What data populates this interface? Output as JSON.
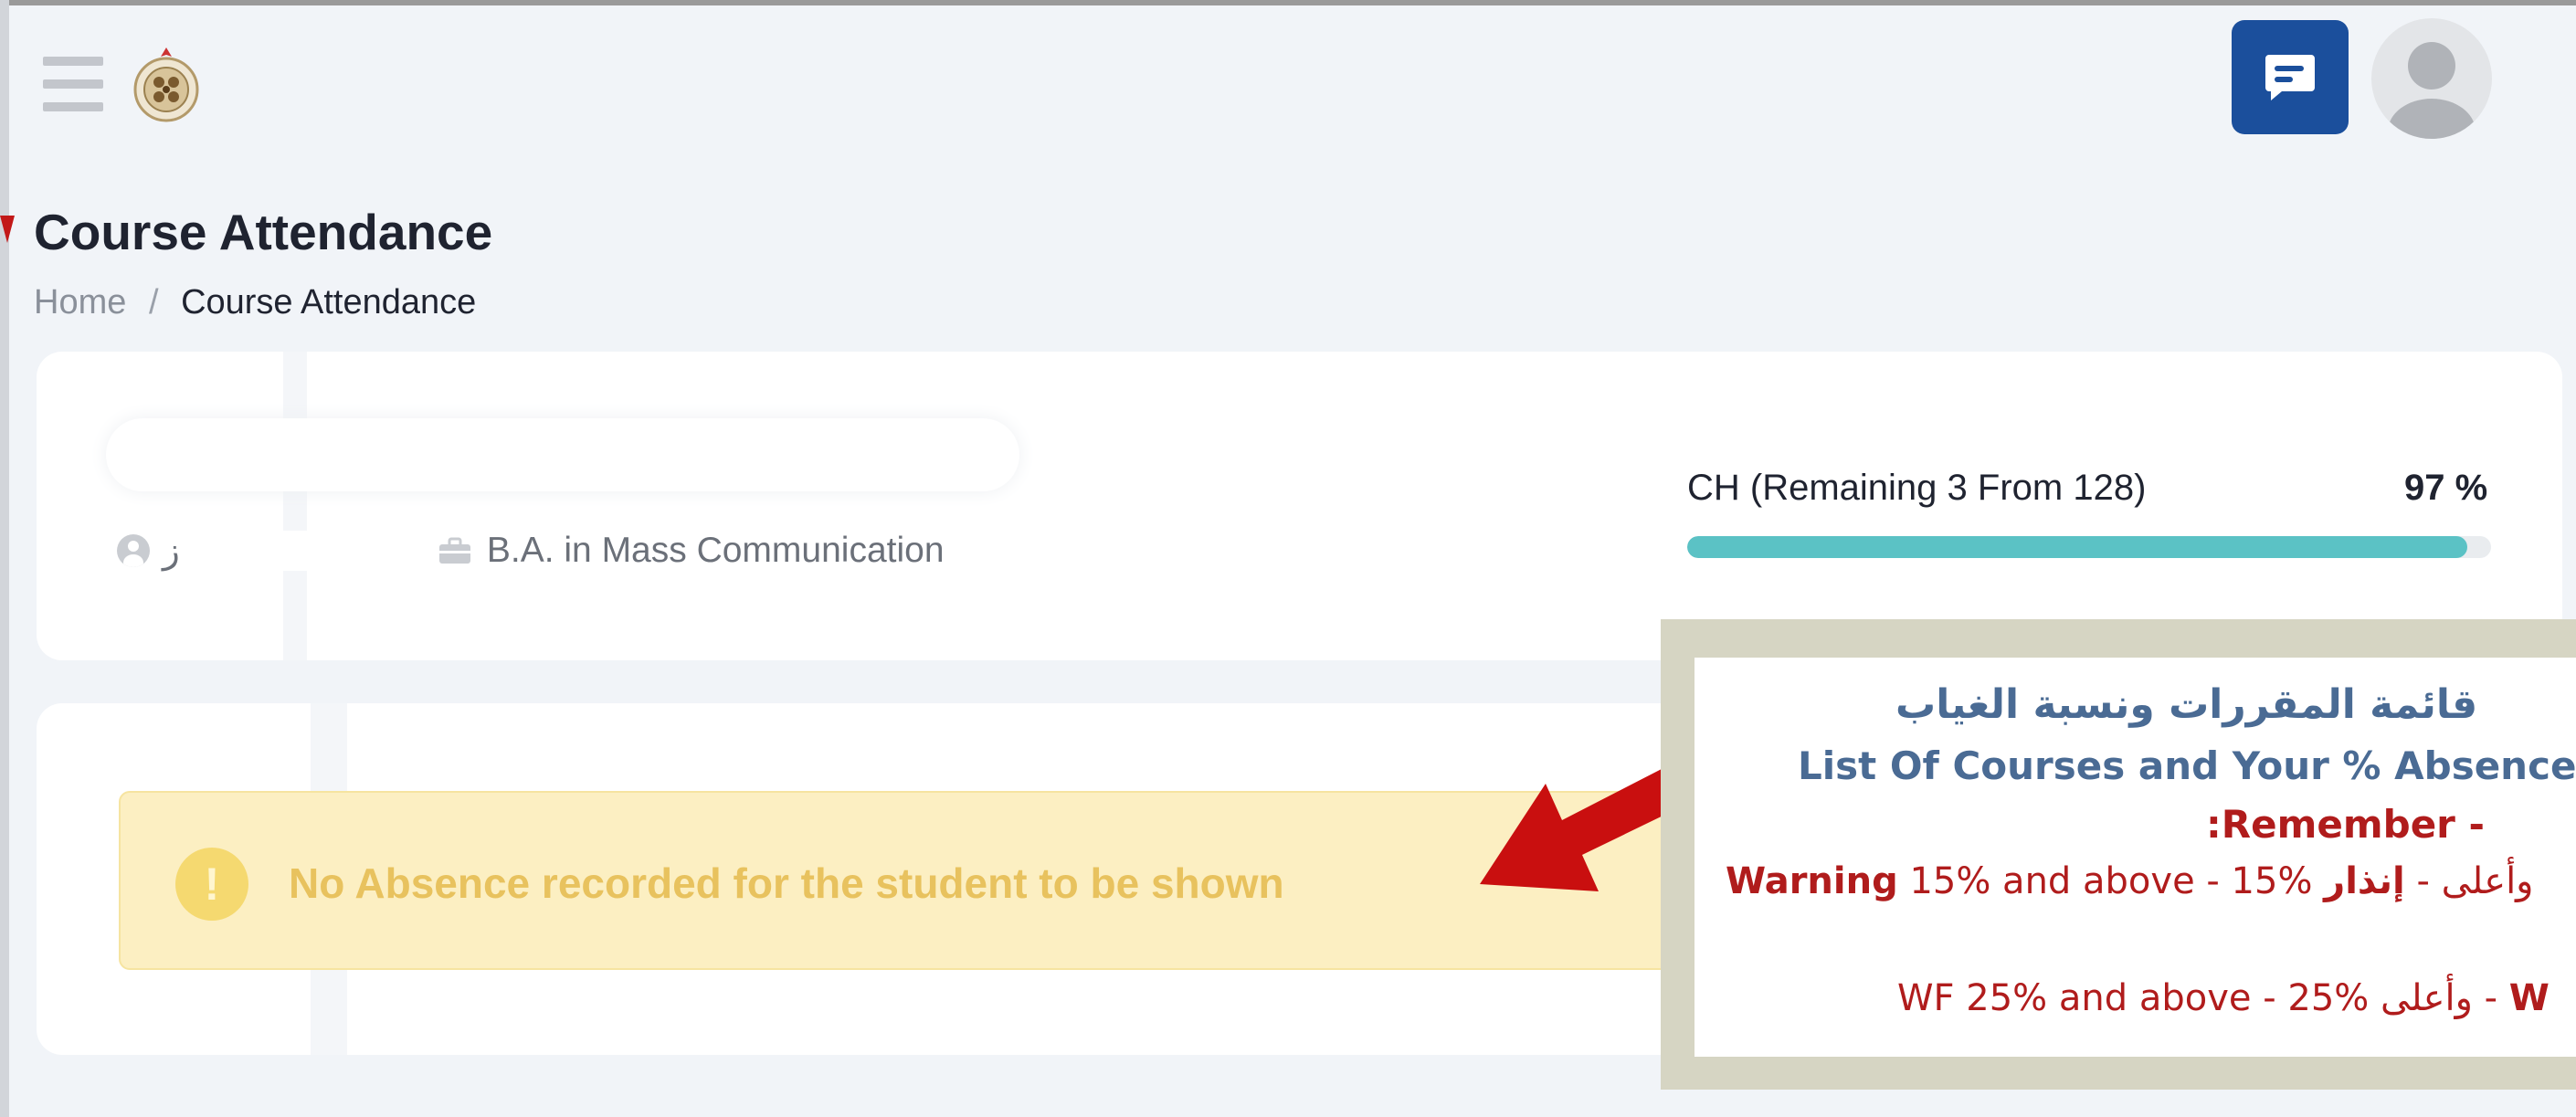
{
  "header": {
    "menu_icon": "hamburger-icon",
    "logo_icon": "university-seal",
    "chat_icon": "chat-icon",
    "avatar_icon": "user-avatar"
  },
  "page": {
    "title": "Course Attendance",
    "breadcrumb": {
      "home": "Home",
      "separator": "/",
      "current": "Course Attendance"
    }
  },
  "student": {
    "program": "B.A. in Mass Communication",
    "name_initial": "ﺯ"
  },
  "credit_hours": {
    "label": "CH (Remaining 3 From 128)",
    "percent_text": "97 %",
    "progress": 0.97,
    "bar_color": "#5bc2c5"
  },
  "alert": {
    "icon": "!",
    "message": "No Absence recorded for the student to be shown",
    "color": "#e8c25e"
  },
  "notice": {
    "title_ar": "قائمة المقررات ونسبة الغياب",
    "title_en": "List Of Courses and Your % Absences",
    "remember": ":Remember - ",
    "warning_line": {
      "ar_label": "إنذار",
      "ar_text": " 15% وأعلى - ",
      "en_text": "15% and above - ",
      "en_label": "Warning"
    },
    "wf_line": {
      "ar_label": "W",
      "ar_text": "  25% وأعلى - ",
      "en_text": "WF 25% and above - "
    }
  },
  "colors": {
    "brand": "#1b4f9c",
    "notice_blue": "#4a6b94",
    "notice_red": "#b01c1c",
    "arrow_red": "#c90f0f"
  }
}
